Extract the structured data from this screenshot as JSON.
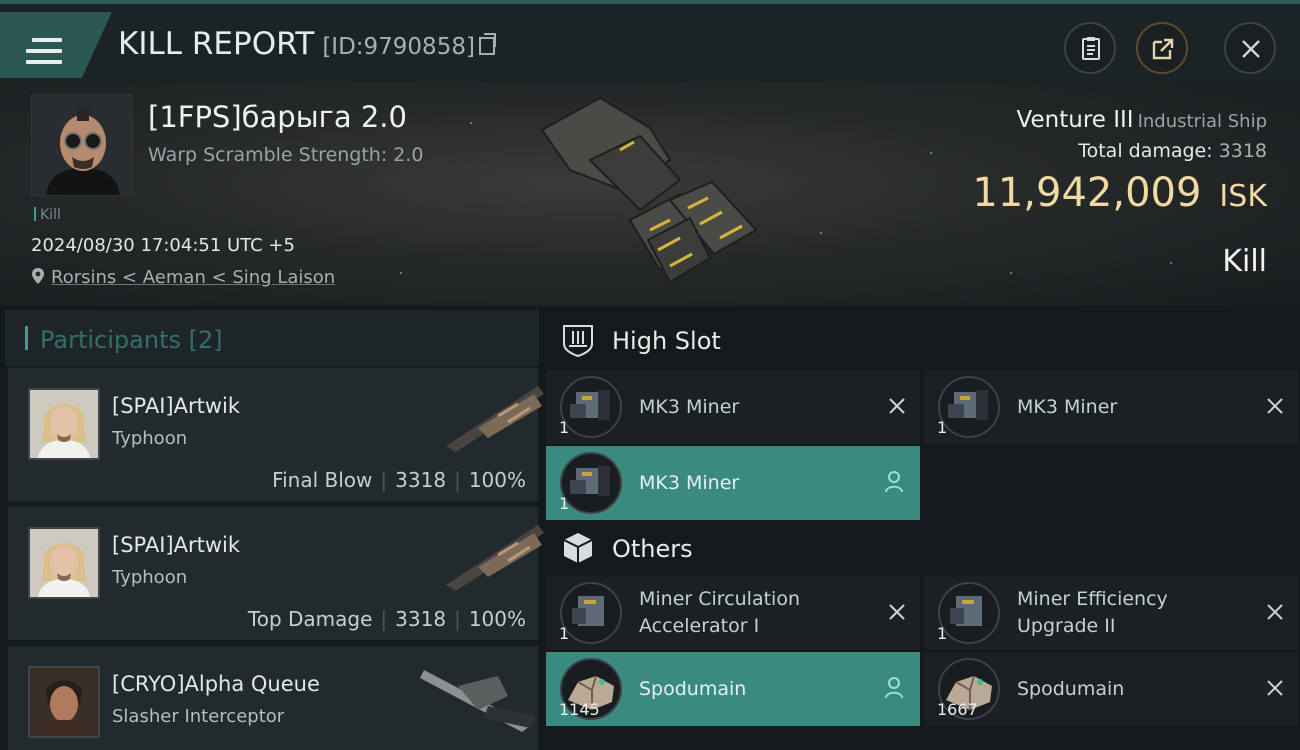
{
  "header": {
    "title": "KILL REPORT",
    "report_id": "[ID:9790858]",
    "menu_icon": "hamburger-menu-icon",
    "buttons": [
      "clipboard-icon",
      "share-icon",
      "close-icon"
    ]
  },
  "victim": {
    "name": "[1FPS]барыга 2.0",
    "subtitle": "Warp Scramble Strength: 2.0",
    "tag": "Kill",
    "timestamp": "2024/08/30 17:04:51 UTC +5",
    "location": "Rorsins < Aeman < Sing Laison",
    "ship_name": "Venture III",
    "ship_class": "Industrial Ship",
    "total_damage_label": "Total damage:",
    "total_damage": "3318",
    "isk_value": "11,942,009",
    "isk_unit": "ISK",
    "result": "Kill"
  },
  "participants": {
    "title": "Participants [2]",
    "rows": [
      {
        "name": "[SPAI]Artwik",
        "ship": "Typhoon",
        "role": "Final Blow",
        "damage": "3318",
        "percent": "100%"
      },
      {
        "name": "[SPAI]Artwik",
        "ship": "Typhoon",
        "role": "Top Damage",
        "damage": "3318",
        "percent": "100%"
      },
      {
        "name": "[CRYO]Alpha Queue",
        "ship": "Slasher Interceptor",
        "badge": "i"
      }
    ]
  },
  "fitting": {
    "high_slot_title": "High Slot",
    "others_title": "Others",
    "high_slot": [
      {
        "label": "MK3 Miner",
        "qty": "1",
        "state": "destroyed"
      },
      {
        "label": "MK3 Miner",
        "qty": "1",
        "state": "destroyed"
      },
      {
        "label": "MK3 Miner",
        "qty": "1",
        "state": "dropped"
      }
    ],
    "others": [
      {
        "label": "Miner Circulation\nAccelerator I",
        "qty": "1",
        "state": "destroyed"
      },
      {
        "label": "Miner Efficiency\nUpgrade II",
        "qty": "1",
        "state": "destroyed"
      },
      {
        "label": "Spodumain",
        "qty": "1145",
        "state": "dropped"
      },
      {
        "label": "Spodumain",
        "qty": "1667",
        "state": "destroyed"
      }
    ]
  },
  "colors": {
    "accent_teal": "#3f9b8e",
    "isk_gold": "#f0d9a3",
    "dropped_highlight": "#3a8a80"
  }
}
